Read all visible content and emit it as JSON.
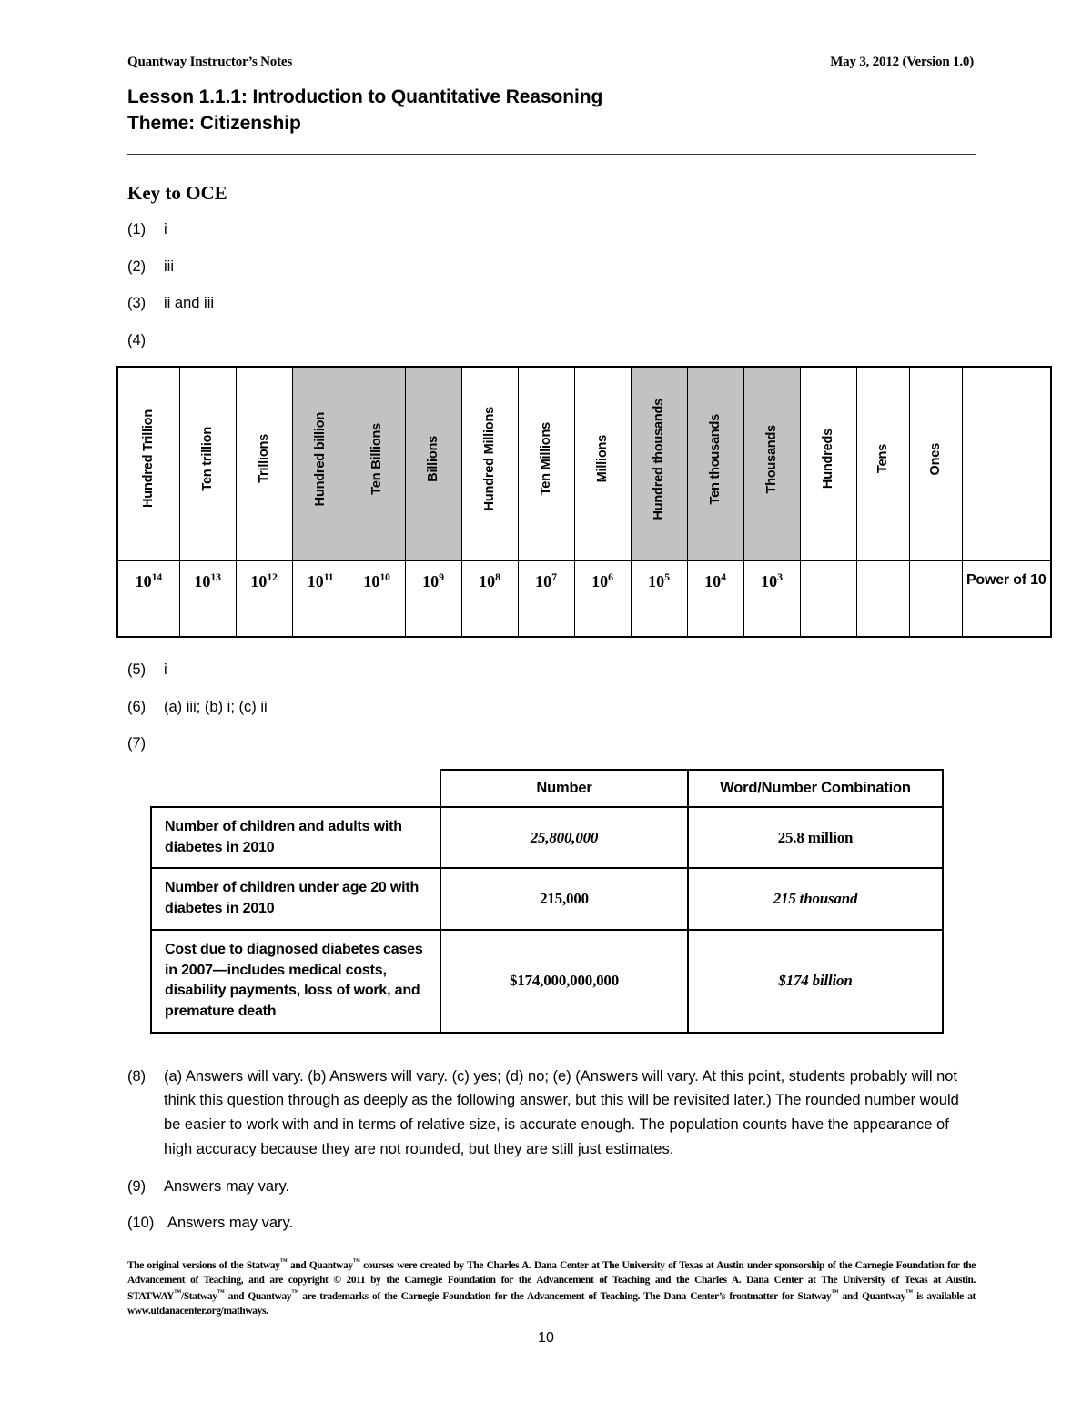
{
  "runhead": {
    "left": "Quantway Instructor’s Notes",
    "right": "May 3, 2012 (Version 1.0)"
  },
  "title": {
    "line1": "Lesson 1.1.1: Introduction to Quantitative Reasoning",
    "line2": "Theme: Citizenship"
  },
  "section_heading": "Key to OCE",
  "answers": {
    "a1_num": "(1)",
    "a1_text": "i",
    "a2_num": "(2)",
    "a2_text": "iii",
    "a3_num": "(3)",
    "a3_text": "ii and iii",
    "a4_num": "(4)",
    "a4_text": "",
    "a5_num": "(5)",
    "a5_text": "i",
    "a6_num": "(6)",
    "a6_text": "(a) iii; (b) i; (c) ii",
    "a7_num": "(7)",
    "a7_text": "",
    "a8_num": "(8)",
    "a8_text": "(a) Answers will vary. (b) Answers will vary. (c) yes; (d) no; (e) (Answers will vary. At this point, students probably will not think this question through as deeply as the following answer, but this will be revisited later.) The rounded number would be easier to work with and in terms of relative size, is accurate enough. The population counts have the appearance of high accuracy because they are not rounded, but they are still just estimates.",
    "a9_num": "(9)",
    "a9_text": "Answers may vary.",
    "a10_num": "(10)",
    "a10_text": "Answers may vary."
  },
  "place_value_table": {
    "columns": [
      {
        "label": "Hundred Trillion",
        "power_base": "10",
        "power_exp": "14",
        "shaded": false
      },
      {
        "label": "Ten trillion",
        "power_base": "10",
        "power_exp": "13",
        "shaded": false
      },
      {
        "label": "Trillions",
        "power_base": "10",
        "power_exp": "12",
        "shaded": false
      },
      {
        "label": "Hundred billion",
        "power_base": "10",
        "power_exp": "11",
        "shaded": true
      },
      {
        "label": "Ten Billions",
        "power_base": "10",
        "power_exp": "10",
        "shaded": true
      },
      {
        "label": "Billions",
        "power_base": "10",
        "power_exp": "9",
        "shaded": true
      },
      {
        "label": "Hundred Millions",
        "power_base": "10",
        "power_exp": "8",
        "shaded": false
      },
      {
        "label": "Ten Millions",
        "power_base": "10",
        "power_exp": "7",
        "shaded": false
      },
      {
        "label": "Millions",
        "power_base": "10",
        "power_exp": "6",
        "shaded": false
      },
      {
        "label": "Hundred thousands",
        "power_base": "10",
        "power_exp": "5",
        "shaded": true
      },
      {
        "label": "Ten thousands",
        "power_base": "10",
        "power_exp": "4",
        "shaded": true
      },
      {
        "label": "Thousands",
        "power_base": "10",
        "power_exp": "3",
        "shaded": true
      },
      {
        "label": "Hundreds",
        "power_base": "",
        "power_exp": "",
        "shaded": false
      },
      {
        "label": "Tens",
        "power_base": "",
        "power_exp": "",
        "shaded": false
      },
      {
        "label": "Ones",
        "power_base": "",
        "power_exp": "",
        "shaded": false
      },
      {
        "label": "",
        "power_base": "",
        "power_exp": "",
        "shaded": false
      }
    ],
    "row_label": "Power of 10",
    "shade_color": "#c2c2c2"
  },
  "diabetes_table": {
    "headers": [
      "",
      "Number",
      "Word/Number Combination"
    ],
    "rows": [
      {
        "label": "Number of children and adults with diabetes in 2010",
        "number": "25,800,000",
        "number_italic": true,
        "words": "25.8 million",
        "words_italic": false
      },
      {
        "label": "Number of children under age 20 with diabetes in 2010",
        "number": "215,000",
        "number_italic": false,
        "words": "215 thousand",
        "words_italic": true
      },
      {
        "label": "Cost due to diagnosed diabetes cases in 2007—includes medical costs, disability payments, loss of work, and premature death",
        "number": "$174,000,000,000",
        "number_italic": false,
        "words": "$174 billion",
        "words_italic": true
      }
    ]
  },
  "footnote": {
    "part1": "The original versions of the Statway",
    "part2": " and Quantway",
    "part3": " courses were created by The Charles A. Dana Center at The University of Texas at Austin under sponsorship of the Carnegie Foundation for the Advancement of Teaching, and are copyright © 2011 by the Carnegie Foundation for the Advancement of Teaching and the Charles A. Dana Center at The University of Texas at Austin. STATWAY",
    "part4": "/Statway",
    "part5": " and Quantway",
    "part6": " are trademarks of the Carnegie Foundation for the Advancement of Teaching. The Dana Center’s frontmatter for Statway",
    "part7": " and Quantway",
    "part8": " is available at www.utdanacenter.org/mathways.",
    "tm_mark": "™"
  },
  "page_number": "10"
}
